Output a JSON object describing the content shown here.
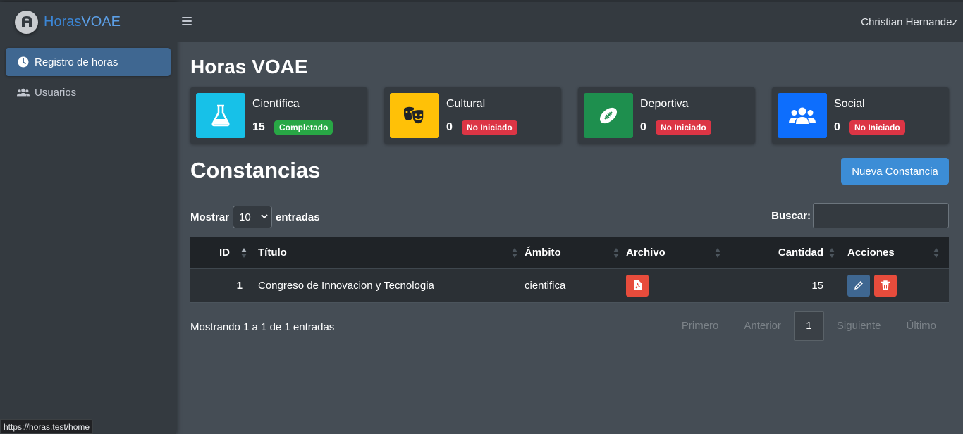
{
  "brand": {
    "part1": "Horas",
    "part2": "VOAE"
  },
  "sidebar": {
    "items": [
      {
        "label": "Registro de horas",
        "icon": "clock-icon",
        "active": true
      },
      {
        "label": "Usuarios",
        "icon": "users-icon",
        "active": false
      }
    ]
  },
  "topbar": {
    "user": "Christian Hernandez"
  },
  "page_title": "Horas VOAE",
  "cards": [
    {
      "title": "Científica",
      "value": "15",
      "status": "Completado",
      "icon": "flask-icon",
      "color": "#17c1e8",
      "status_color": "#28a745"
    },
    {
      "title": "Cultural",
      "value": "0",
      "status": "No Iniciado",
      "icon": "theater-masks-icon",
      "color": "#ffc107",
      "status_color": "#dc3545"
    },
    {
      "title": "Deportiva",
      "value": "0",
      "status": "No Iniciado",
      "icon": "football-icon",
      "color": "#1e8f4e",
      "status_color": "#dc3545"
    },
    {
      "title": "Social",
      "value": "0",
      "status": "No Iniciado",
      "icon": "users-icon",
      "color": "#0d6efd",
      "status_color": "#dc3545"
    }
  ],
  "section": {
    "title": "Constancias",
    "new_button": "Nueva Constancia"
  },
  "controls": {
    "show_label": "Mostrar",
    "show_value": "10",
    "entries_label": "entradas",
    "search_label": "Buscar:"
  },
  "table": {
    "headers": [
      "ID",
      "Título",
      "Ámbito",
      "Archivo",
      "Cantidad",
      "Acciones"
    ],
    "rows": [
      {
        "id": "1",
        "titulo": "Congreso de Innovacion y Tecnologia",
        "ambito": "cientifica",
        "cantidad": "15"
      }
    ]
  },
  "footer": {
    "info": "Mostrando 1 a 1 de 1 entradas",
    "pager": {
      "first": "Primero",
      "prev": "Anterior",
      "current": "1",
      "next": "Siguiente",
      "last": "Último"
    }
  },
  "statusbar": {
    "url": "https://horas.test/home"
  }
}
